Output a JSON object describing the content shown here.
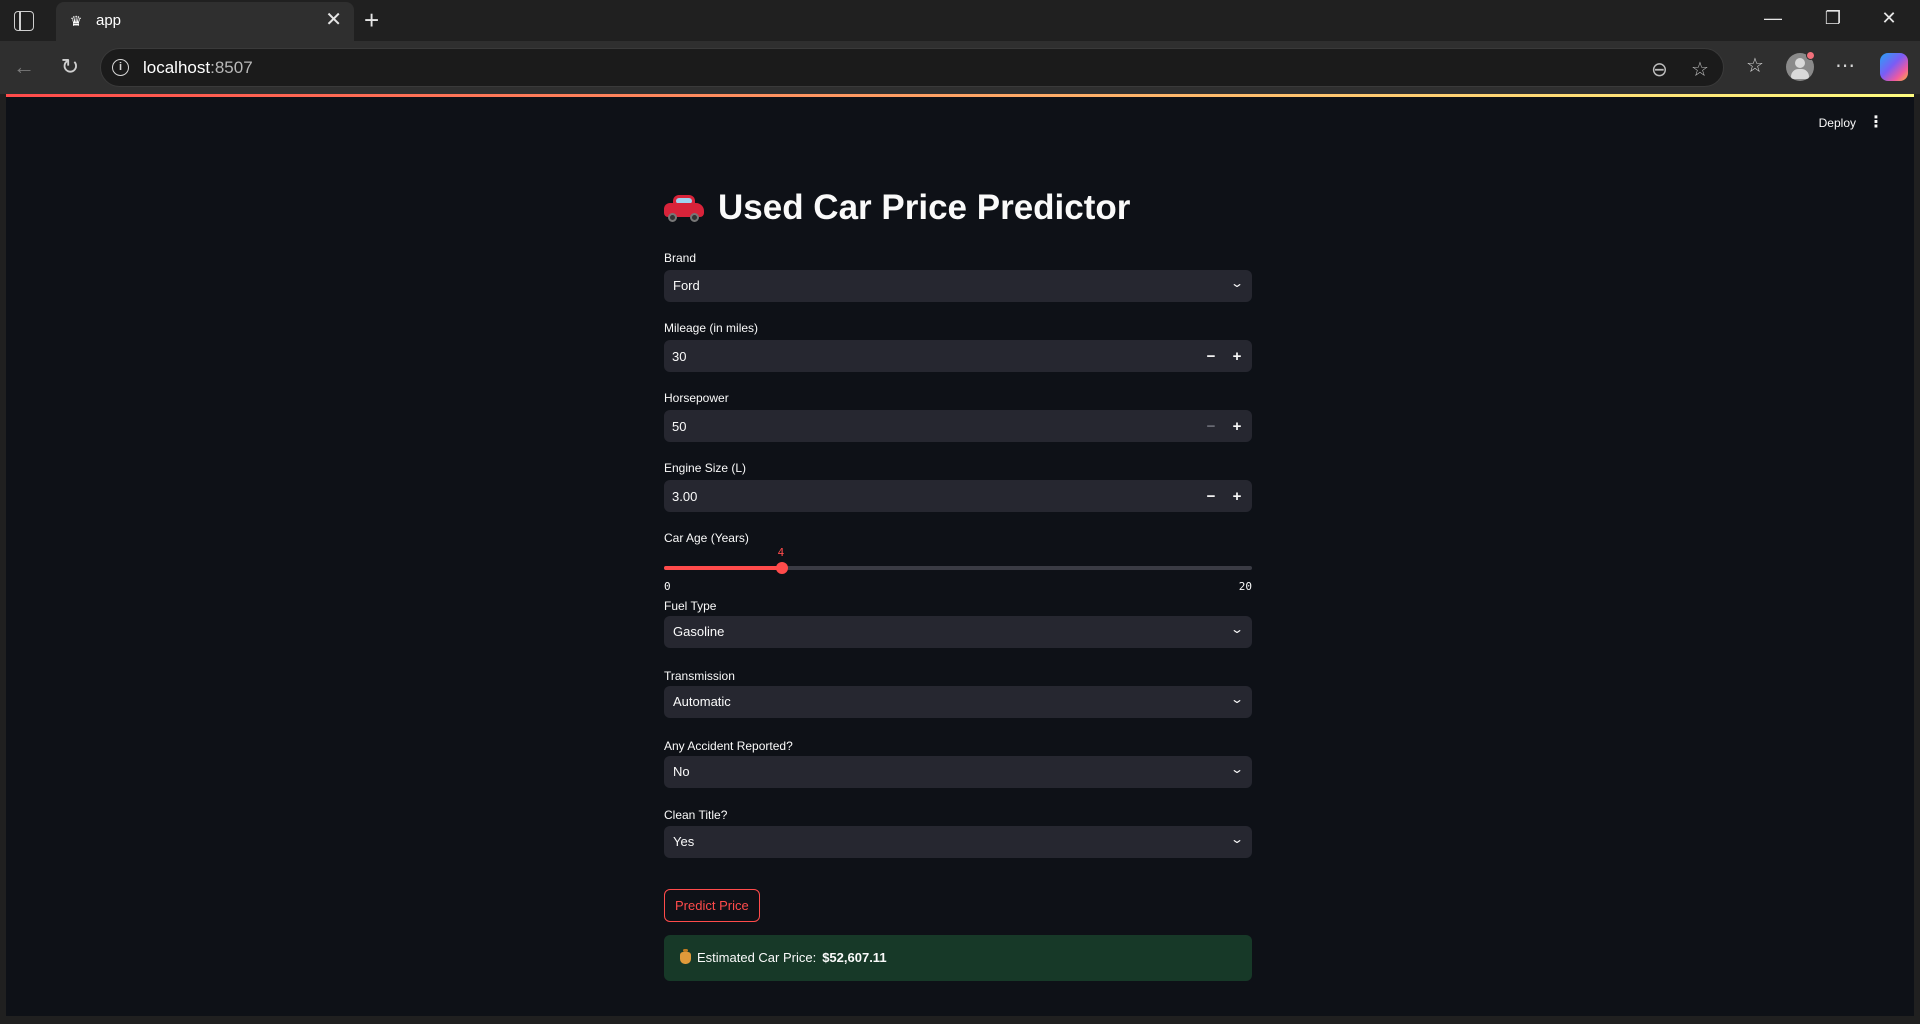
{
  "browser": {
    "tab_title": "app",
    "url_host": "localhost",
    "url_port": ":8507"
  },
  "app": {
    "deploy_label": "Deploy",
    "title": "Used Car Price Predictor",
    "title_emoji": "car-icon",
    "accent_color": "#ff4b4b",
    "fields": {
      "brand": {
        "label": "Brand",
        "value": "Ford"
      },
      "mileage": {
        "label": "Mileage (in miles)",
        "value": "30"
      },
      "horsepower": {
        "label": "Horsepower",
        "value": "50"
      },
      "engine_size": {
        "label": "Engine Size (L)",
        "value": "3.00"
      },
      "car_age": {
        "label": "Car Age (Years)",
        "value": 4,
        "value_text": "4",
        "min": "0",
        "max": "20",
        "min_num": 0,
        "max_num": 20
      },
      "fuel_type": {
        "label": "Fuel Type",
        "value": "Gasoline"
      },
      "transmission": {
        "label": "Transmission",
        "value": "Automatic"
      },
      "accident": {
        "label": "Any Accident Reported?",
        "value": "No"
      },
      "clean_title": {
        "label": "Clean Title?",
        "value": "Yes"
      }
    },
    "predict_button": "Predict Price",
    "result": {
      "label": "Estimated Car Price:",
      "amount": "$52,607.11"
    }
  }
}
